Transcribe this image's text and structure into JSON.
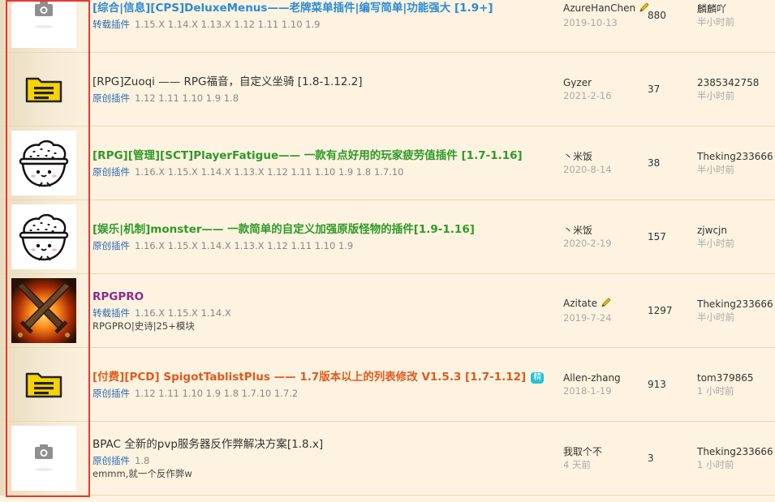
{
  "colors": {
    "title_default": "#333333",
    "title_blue": "#2a8bd6",
    "title_green": "#2e9a28",
    "title_purple": "#8e2a8e",
    "title_red": "#e25a1c",
    "tag": "#2a6ab6",
    "highlight": "#e53935"
  },
  "threads": [
    {
      "thumb": "camera-icon",
      "title": "[综合|信息][CPS]DeluxeMenus——老牌菜单插件|编写简单|功能强大 [1.9+]",
      "title_color": "#2a8bd6",
      "bold": true,
      "tag": "转载插件",
      "versions": "1.15.X 1.14.X 1.13.X 1.12 1.11 1.10 1.9",
      "desc": "",
      "badge": "",
      "author": "AzureHanChen",
      "author_icon": "pencil-icon",
      "date": "2019-10-13",
      "replies": "880",
      "last_poster": "麟麟吖",
      "last_time": "半小时前"
    },
    {
      "thumb": "folder-icon",
      "title": "[RPG]Zuoqi —— RPG福音，自定义坐骑 [1.8-1.12.2]",
      "title_color": "#333333",
      "bold": false,
      "tag": "原创插件",
      "versions": "1.12 1.11 1.10 1.9 1.8",
      "desc": "",
      "badge": "",
      "author": "Gyzer",
      "author_icon": "",
      "date": "2021-2-16",
      "replies": "37",
      "last_poster": "2385342758",
      "last_time": "半小时前"
    },
    {
      "thumb": "rice-bowl-icon",
      "title": "[RPG][管理][SCT]PlayerFatigue—— 一款有点好用的玩家疲劳值插件 [1.7-1.16]",
      "title_color": "#2e9a28",
      "bold": true,
      "tag": "原创插件",
      "versions": "1.16.X 1.15.X 1.14.X 1.13.X 1.12 1.11 1.10 1.9 1.8 1.7.10",
      "desc": "",
      "badge": "",
      "author": "丶米饭",
      "author_icon": "",
      "date": "2020-8-14",
      "replies": "38",
      "last_poster": "Theking233666",
      "last_time": "半小时前"
    },
    {
      "thumb": "rice-bowl-icon",
      "title": "[娱乐|机制]monster—— 一款简单的自定义加强原版怪物的插件[1.9-1.16]",
      "title_color": "#2e9a28",
      "bold": true,
      "tag": "原创插件",
      "versions": "1.16.X 1.15.X 1.14.X 1.13.X 1.12 1.11 1.10 1.9",
      "desc": "",
      "badge": "",
      "author": "丶米饭",
      "author_icon": "",
      "date": "2020-2-19",
      "replies": "157",
      "last_poster": "zjwcjn",
      "last_time": "半小时前"
    },
    {
      "thumb": "crossed-swords-icon",
      "title": "RPGPRO",
      "title_color": "#8e2a8e",
      "bold": true,
      "tag": "转载插件",
      "versions": "1.16.X 1.15.X 1.14.X",
      "desc": "RPGPRO|史诗|25+模块",
      "badge": "",
      "author": "Azitate",
      "author_icon": "pencil-icon",
      "date": "2019-7-24",
      "replies": "1297",
      "last_poster": "Theking233666",
      "last_time": "半小时前"
    },
    {
      "thumb": "folder-icon",
      "title": "[付费][PCD] SpigotTablistPlus —— 1.7版本以上的列表修改 V1.5.3 [1.7-1.12]",
      "title_color": "#e25a1c",
      "bold": true,
      "tag": "原创插件",
      "versions": "1.12 1.11 1.10 1.9 1.8 1.7.10 1.7.2",
      "desc": "",
      "badge": "精",
      "author": "Allen-zhang",
      "author_icon": "",
      "date": "2018-1-19",
      "replies": "913",
      "last_poster": "tom379865",
      "last_time": "1 小时前"
    },
    {
      "thumb": "camera-icon",
      "title": "BPAC 全新的pvp服务器反作弊解决方案[1.8.x]",
      "title_color": "#333333",
      "bold": false,
      "tag": "原创插件",
      "versions": "1.8",
      "desc": "emmm,就一个反作弊w",
      "badge": "",
      "author": "我取个不",
      "author_icon": "",
      "date": "4 天前",
      "replies": "3",
      "last_poster": "Theking233666",
      "last_time": "1 小时前"
    }
  ]
}
